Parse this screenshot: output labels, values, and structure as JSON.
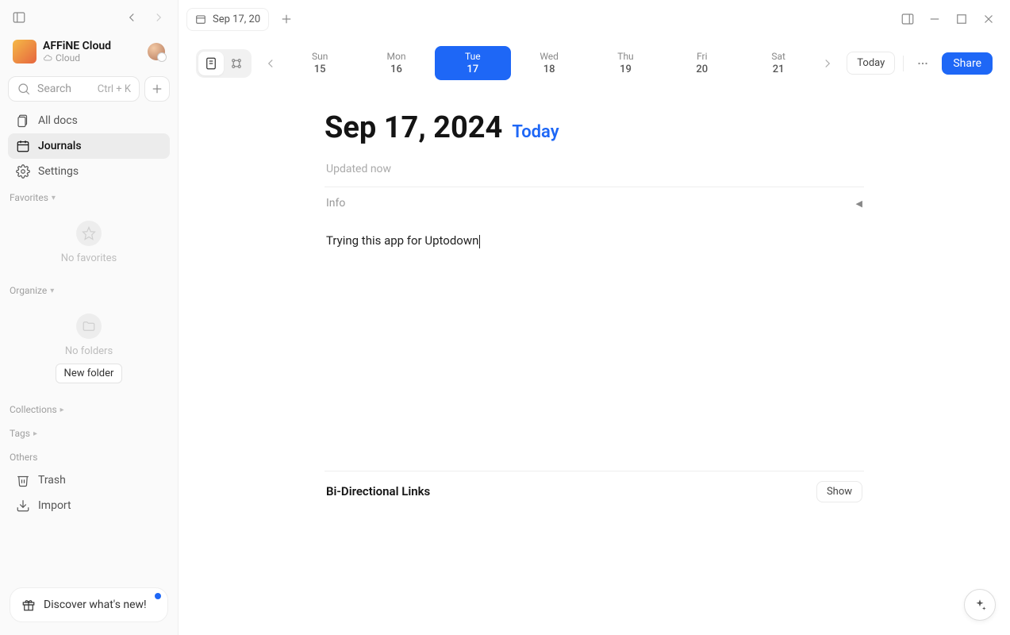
{
  "workspace": {
    "name": "AFFiNE Cloud",
    "sub": "Cloud"
  },
  "search": {
    "placeholder": "Search",
    "kbd": "Ctrl + K"
  },
  "nav": {
    "all_docs": "All docs",
    "journals": "Journals",
    "settings": "Settings"
  },
  "sections": {
    "favorites": "Favorites",
    "organize": "Organize",
    "collections": "Collections",
    "tags": "Tags",
    "others": "Others"
  },
  "empty": {
    "no_favorites": "No favorites",
    "no_folders": "No folders",
    "new_folder": "New folder"
  },
  "others": {
    "trash": "Trash",
    "import": "Import"
  },
  "discover": "Discover what's new!",
  "tab": {
    "label": "Sep 17, 20"
  },
  "days": [
    {
      "dow": "Sun",
      "num": "15"
    },
    {
      "dow": "Mon",
      "num": "16"
    },
    {
      "dow": "Tue",
      "num": "17"
    },
    {
      "dow": "Wed",
      "num": "18"
    },
    {
      "dow": "Thu",
      "num": "19"
    },
    {
      "dow": "Fri",
      "num": "20"
    },
    {
      "dow": "Sat",
      "num": "21"
    }
  ],
  "buttons": {
    "today": "Today",
    "share": "Share",
    "show": "Show"
  },
  "doc": {
    "title": "Sep 17, 2024",
    "today_label": "Today",
    "updated": "Updated now",
    "info": "Info",
    "body": "Trying this app for Uptodown",
    "links_label": "Bi-Directional Links"
  }
}
